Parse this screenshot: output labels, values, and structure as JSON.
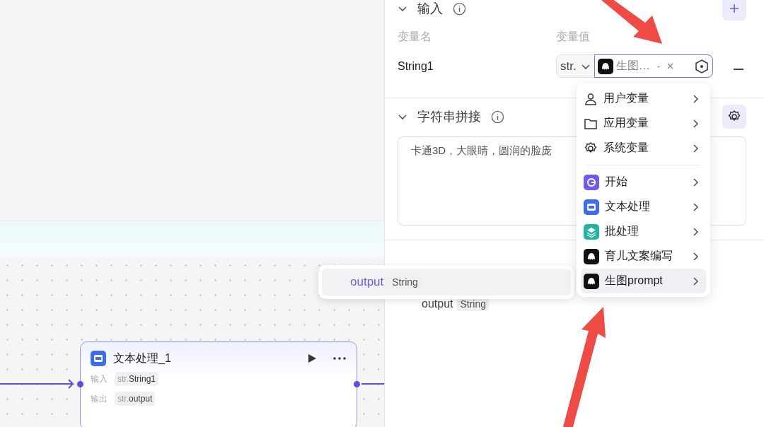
{
  "canvas": {
    "node": {
      "title": "文本处理_1",
      "rows": [
        {
          "label": "输入",
          "type": "str.",
          "value": "String1"
        },
        {
          "label": "输出",
          "type": "str.",
          "value": "output"
        }
      ]
    }
  },
  "panel": {
    "input_section": {
      "title": "输入",
      "expanded": true,
      "columns": [
        "变量名",
        "变量值"
      ],
      "variables": [
        {
          "name": "String1",
          "type": "str.",
          "reference": "生图…",
          "separator": "-"
        }
      ]
    },
    "concat_section": {
      "title": "字符串拼接",
      "expanded": true,
      "text": "卡通3D，大眼睛，圆润的脸庞"
    },
    "output_section": {
      "variables": [
        {
          "name": "output",
          "type": "String"
        }
      ]
    }
  },
  "variable_menu": {
    "items": [
      {
        "kind": "user",
        "label": "用户变量",
        "selected": false
      },
      {
        "kind": "app",
        "label": "应用变量",
        "selected": false
      },
      {
        "kind": "system",
        "label": "系统变量",
        "selected": false
      },
      {
        "kind": "start",
        "label": "开始",
        "selected": false
      },
      {
        "kind": "text",
        "label": "文本处理",
        "selected": false
      },
      {
        "kind": "batch",
        "label": "批处理",
        "selected": false
      },
      {
        "kind": "bot",
        "label": "育儿文案编写",
        "selected": false
      },
      {
        "kind": "bot",
        "label": "生图prompt",
        "selected": true
      }
    ]
  },
  "output_submenu": {
    "items": [
      {
        "name": "output",
        "type": "String",
        "selected": true
      }
    ]
  }
}
